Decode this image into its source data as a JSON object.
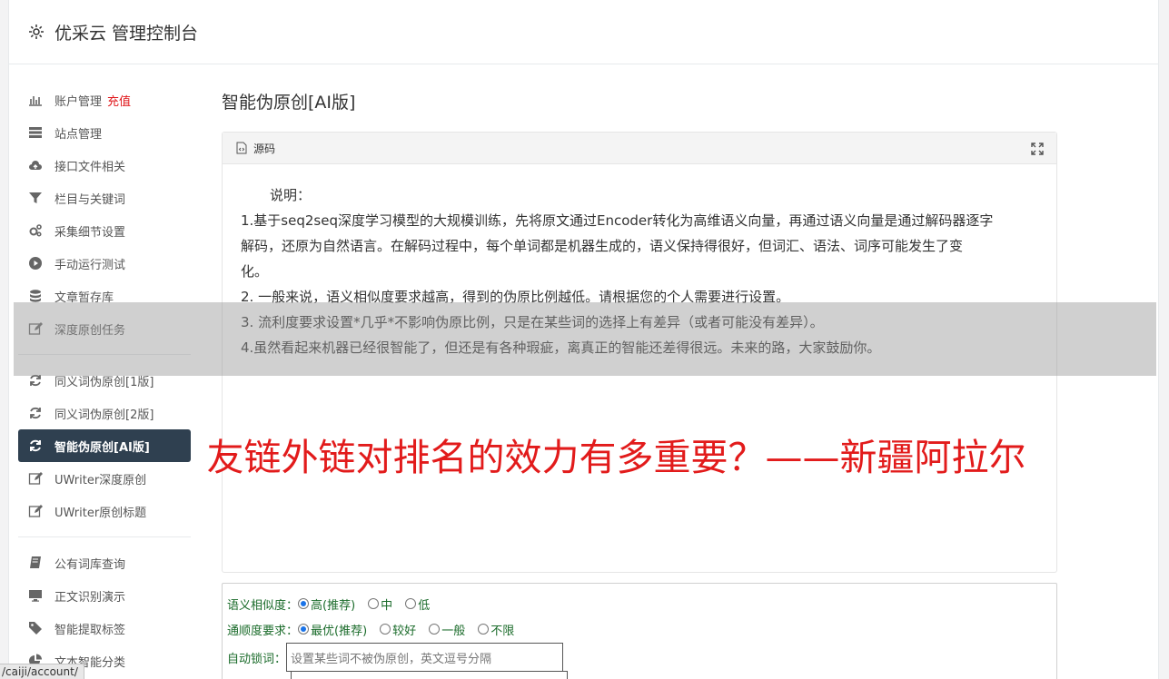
{
  "header": {
    "title": "优采云 管理控制台"
  },
  "sidebar": {
    "group1": [
      {
        "label": "账户管理",
        "extra": "充值",
        "icon": "bar-chart-icon"
      },
      {
        "label": "站点管理",
        "icon": "server-icon"
      },
      {
        "label": "接口文件相关",
        "icon": "cloud-upload-icon"
      },
      {
        "label": "栏目与关键词",
        "icon": "filter-icon"
      },
      {
        "label": "采集细节设置",
        "icon": "gears-icon"
      },
      {
        "label": "手动运行测试",
        "icon": "play-circle-icon"
      },
      {
        "label": "文章暂存库",
        "icon": "database-icon"
      },
      {
        "label": "深度原创任务",
        "icon": "edit-icon"
      }
    ],
    "group2": [
      {
        "label": "同义词伪原创[1版]",
        "icon": "refresh-icon"
      },
      {
        "label": "同义词伪原创[2版]",
        "icon": "refresh-icon"
      },
      {
        "label": "智能伪原创[AI版]",
        "icon": "refresh-icon"
      },
      {
        "label": "UWriter深度原创",
        "icon": "edit-icon"
      },
      {
        "label": "UWriter原创标题",
        "icon": "edit-icon"
      }
    ],
    "group3": [
      {
        "label": "公有词库查询",
        "icon": "book-icon"
      },
      {
        "label": "正文识别演示",
        "icon": "monitor-icon"
      },
      {
        "label": "智能提取标签",
        "icon": "tag-icon"
      },
      {
        "label": "文本智能分类",
        "icon": "pie-chart-icon"
      }
    ]
  },
  "main": {
    "title": "智能伪原创[AI版]",
    "editor": {
      "source_label": "源码",
      "desc_title": "说明：",
      "lines": [
        "1.基于seq2seq深度学习模型的大规模训练，先将原文通过Encoder转化为高维语义向量，再通过语义向量是通过解码器逐字",
        "解码，还原为自然语言。在解码过程中，每个单词都是机器生成的，语义保持得很好，但词汇、语法、词序可能发生了变",
        "化。",
        "2. 一般来说，语义相似度要求越高，得到的伪原比例越低。请根据您的个人需要进行设置。",
        "3. 流利度要求设置*几乎*不影响伪原比例，只是在某些词的选择上有差异（或者可能没有差异）。",
        "4.虽然看起来机器已经很智能了，但还是有各种瑕疵，离真正的智能还差得很远。未来的路，大家鼓励你。"
      ]
    },
    "form": {
      "similarity_label": "语义相似度：",
      "similarity_options": [
        "高(推荐)",
        "中",
        "低"
      ],
      "fluency_label": "通顺度要求：",
      "fluency_options": [
        "最优(推荐)",
        "较好",
        "一般",
        "不限"
      ],
      "lock_label": "自动锁词：",
      "lock_placeholder": "设置某些词不被伪原创，英文逗号分隔"
    }
  },
  "overlay": {
    "text": "友链外链对排名的效力有多重要？——新疆阿拉尔"
  },
  "statusbar": {
    "url": "/caiji/account/"
  },
  "colors": {
    "active_bg": "#2f4050",
    "recharge": "#e0161a",
    "overlay_text": "#e21b1b",
    "form_label": "#1a6b2a"
  }
}
